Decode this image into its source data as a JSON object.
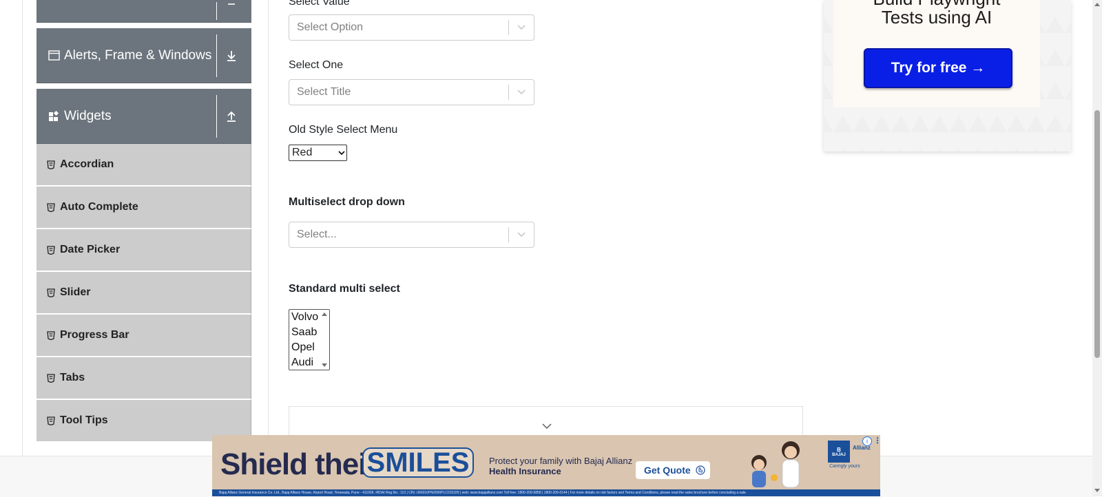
{
  "sidebar": {
    "groups": [
      {
        "label": "",
        "icon": "book-icon",
        "toggle_icon": "collapse-icon"
      },
      {
        "label": "Alerts, Frame & Windows",
        "icon": "window-icon",
        "toggle_icon": "download-arrow-icon"
      },
      {
        "label": "Widgets",
        "icon": "widgets-icon",
        "toggle_icon": "upload-arrow-icon"
      }
    ],
    "items": [
      {
        "label": "Accordian",
        "icon": "html5-icon"
      },
      {
        "label": "Auto Complete",
        "icon": "html5-icon"
      },
      {
        "label": "Date Picker",
        "icon": "html5-icon"
      },
      {
        "label": "Slider",
        "icon": "html5-icon"
      },
      {
        "label": "Progress Bar",
        "icon": "html5-icon"
      },
      {
        "label": "Tabs",
        "icon": "html5-icon"
      },
      {
        "label": "Tool Tips",
        "icon": "html5-icon"
      }
    ]
  },
  "form": {
    "select_value": {
      "label": "Select Value",
      "placeholder": "Select Option"
    },
    "select_one": {
      "label": "Select One",
      "placeholder": "Select Title"
    },
    "old_style": {
      "label": "Old Style Select Menu",
      "value": "Red"
    },
    "multiselect": {
      "label": "Multiselect drop down",
      "placeholder": "Select..."
    },
    "standard_multi": {
      "label": "Standard multi select",
      "options": [
        "Volvo",
        "Saab",
        "Opel",
        "Audi"
      ]
    }
  },
  "ad_right": {
    "title_line1": "Build Playwright",
    "title_line2": "Tests using AI",
    "button_label": "Try for free →"
  },
  "ad_bottom": {
    "headline": "Shield their",
    "highlight": "SMILES",
    "text_line1": "Protect your family with Bajaj Allianz",
    "text_line2": "Health Insurance",
    "button_label": "Get Quote",
    "brand": "BAJAJ",
    "brand2": "Allianz",
    "tagline": "Caringly yours",
    "fine_print": "Bajaj Allianz General Insurance Co. Ltd., Bajaj Allianz House, Airport Road, Yerawada, Pune - 411006. IRDAI Reg.No.: 113 | CIN: U66010PN2000PLC015329 | web: www.bajajallianz.com Toll free: 1800-209-5858 | 1800-209-0144 | For more details on risk factors and Terms and Conditions, please read the sales brochure before concluding a sale."
  },
  "colors": {
    "sidebar_header": "#6c757d",
    "sidebar_item": "#cccccc",
    "ad_button": "#0a1fe6",
    "ad_bottom_bg": "#d9c5b0",
    "brand_blue": "#1a4f9a"
  }
}
